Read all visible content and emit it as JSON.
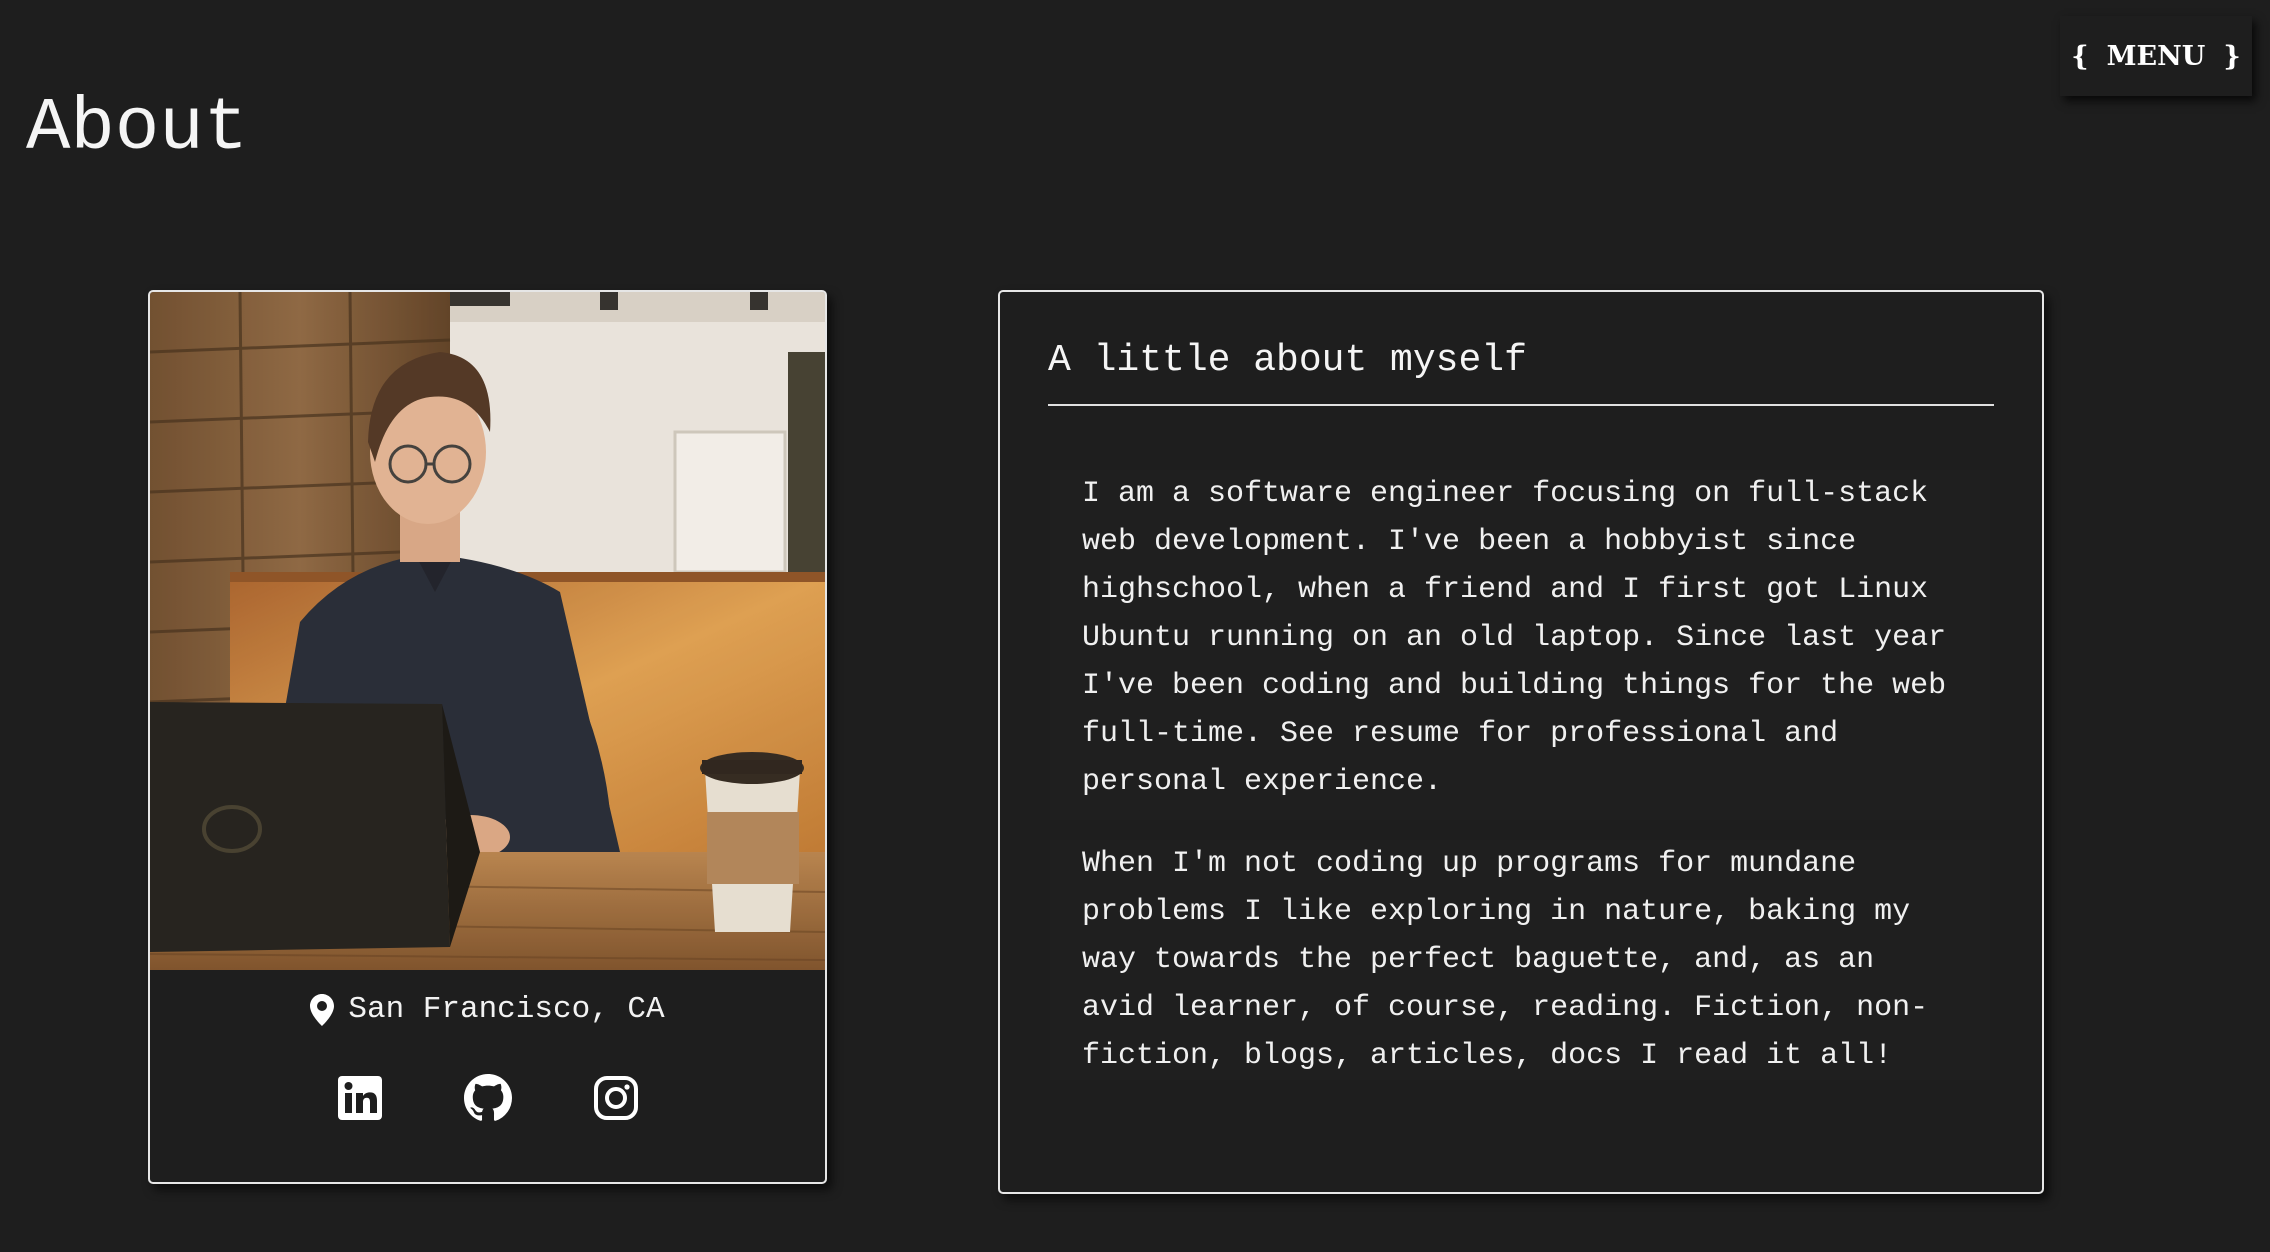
{
  "page": {
    "title": "About"
  },
  "menu": {
    "open_brace": "{",
    "label": "MENU",
    "close_brace": "}"
  },
  "profile": {
    "location": "San Francisco, CA",
    "social": [
      {
        "name": "LinkedIn",
        "icon": "linkedin-icon"
      },
      {
        "name": "GitHub",
        "icon": "github-icon"
      },
      {
        "name": "Instagram",
        "icon": "instagram-icon"
      }
    ]
  },
  "about": {
    "heading": "A little about myself",
    "paragraphs": [
      "I am a software engineer focusing on full-stack web development. I've been a hobbyist since highschool, when a friend and I first got Linux Ubuntu running on an old laptop. Since last year I've been coding and building things for the web full-time. See resume for professional and personal experience.",
      "When I'm not coding up programs for mundane problems I like exploring in nature, baking my way towards the perfect baguette, and, as an avid learner, of course, reading. Fiction, non-fiction, blogs, articles, docs I read it all!"
    ]
  },
  "colors": {
    "background": "#1e1e1e",
    "text": "#f2f2f2",
    "border": "#e6e6e6"
  }
}
